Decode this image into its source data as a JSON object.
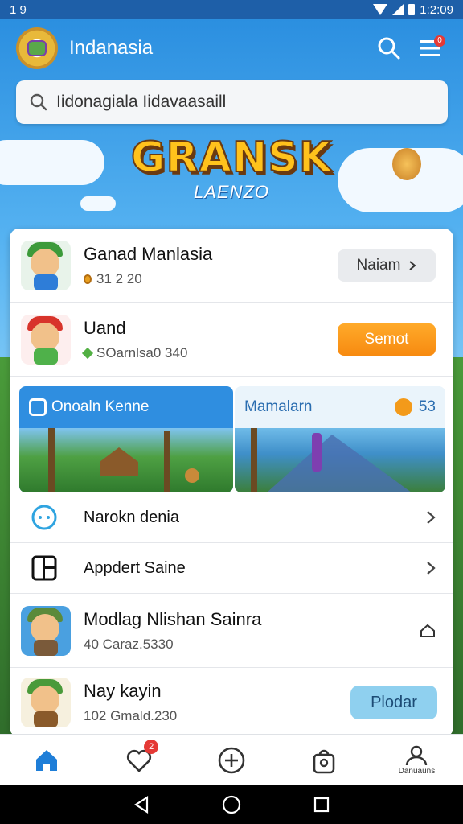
{
  "status_bar": {
    "left_text": "1 9",
    "time": "1:2:09"
  },
  "header": {
    "title": "Indanasia",
    "menu_badge": "0"
  },
  "search": {
    "placeholder": "Iidonagiala Iidavaasaill"
  },
  "banner": {
    "title": "GRANSK",
    "subtitle": "LAENZO"
  },
  "items": [
    {
      "title": "Ganad Manlasia",
      "sub": "31 2 20",
      "button": "Naiam",
      "hat_color": "#3c9a3a",
      "body_color": "#2e7dd8"
    },
    {
      "title": "Uand",
      "sub": "SOarnlsa0 340",
      "button": "Semot",
      "hat_color": "#d8342b",
      "body_color": "#4fb14a"
    }
  ],
  "tiles": [
    {
      "label": "Onoaln Kenne",
      "accent": "#2f8ee0"
    },
    {
      "label": "Mamalarn",
      "count": "53",
      "accent": "#eaf4fb"
    }
  ],
  "list_rows": [
    {
      "label": "Narokn denia"
    },
    {
      "label": "Appdert Saine"
    }
  ],
  "more_items": [
    {
      "title": "Modlag Nlishan Sainra",
      "sub": "40 Caraz.5330"
    },
    {
      "title": "Nay kayin",
      "sub": "102 Gmald.230",
      "button": "Plodar"
    }
  ],
  "bottom_nav": {
    "badge": "2",
    "profile_label": "Danuauns"
  },
  "colors": {
    "primary": "#2a8ad8",
    "orange": "#f78a10",
    "light_blue": "#8fd0ef"
  }
}
